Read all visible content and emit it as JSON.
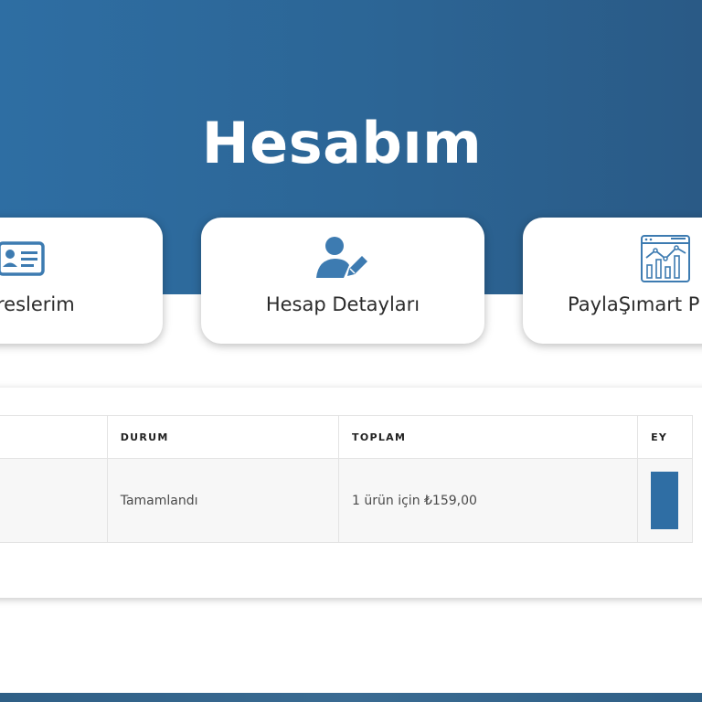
{
  "page": {
    "title": "Hesabım"
  },
  "nav_cards": [
    {
      "label": "reslerim",
      "icon": "address-card-icon"
    },
    {
      "label": "Hesap Detayları",
      "icon": "user-edit-icon"
    },
    {
      "label": "PaylaŞımart P",
      "icon": "analytics-chart-icon"
    }
  ],
  "orders_table": {
    "headers": [
      "",
      "DURUM",
      "TOPLAM",
      "EY"
    ],
    "rows": [
      {
        "order": "",
        "status": "Tamamlandı",
        "total": "1 ürün için ₺159,00"
      }
    ]
  },
  "colors": {
    "hero": "#2e6ea3",
    "accent": "#2f6ea4",
    "icon": "#3d7bb1"
  }
}
